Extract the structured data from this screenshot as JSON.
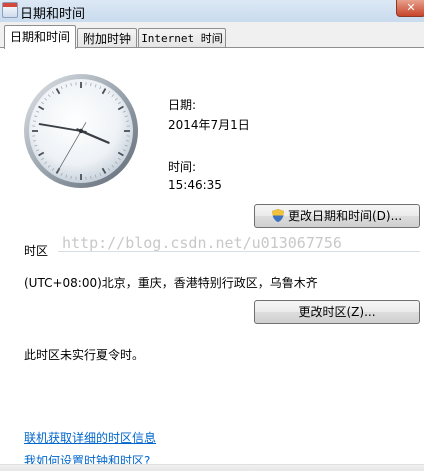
{
  "window": {
    "title": "日期和时间",
    "close_glyph": "✕"
  },
  "tabs": [
    {
      "label": "日期和时间",
      "active": true
    },
    {
      "label": "附加时钟",
      "active": false
    },
    {
      "label": "Internet 时间",
      "active": false
    }
  ],
  "datetime": {
    "date_label": "日期:",
    "date_value": "2014年7月1日",
    "time_label": "时间:",
    "time_value": "15:46:35",
    "change_button": "更改日期和时间(D)..."
  },
  "timezone": {
    "header": "时区",
    "value": "(UTC+08:00)北京，重庆，香港特别行政区，乌鲁木齐",
    "change_button": "更改时区(Z)...",
    "dst_note": "此时区未实行夏令时。"
  },
  "links": {
    "online_tz_info": "联机获取详细的时区信息",
    "how_to_set": "我如何设置时钟和时区?"
  },
  "watermark": "http://blog.csdn.net/u013067756",
  "colors": {
    "link": "#0066cc",
    "titlebar": "#dce8f5"
  },
  "icons": [
    "calendar-icon",
    "close-icon",
    "analog-clock",
    "shield-icon"
  ]
}
